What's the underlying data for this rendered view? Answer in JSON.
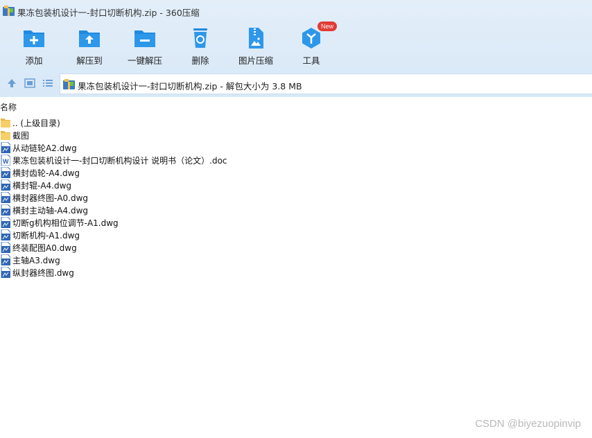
{
  "window": {
    "title": "果冻包装机设计一-封口切断机构.zip - 360压缩"
  },
  "toolbar": {
    "items": [
      {
        "label": "添加",
        "icon": "add-icon"
      },
      {
        "label": "解压到",
        "icon": "extract-to-icon"
      },
      {
        "label": "一键解压",
        "icon": "one-click-extract-icon"
      },
      {
        "label": "删除",
        "icon": "recycle-delete-icon"
      },
      {
        "label": "图片压缩",
        "icon": "image-compress-icon"
      },
      {
        "label": "工具",
        "icon": "tools-icon",
        "badge": "New"
      }
    ]
  },
  "nav": {
    "path": "果冻包装机设计一-封口切断机构.zip - 解包大小为 3.8 MB"
  },
  "list": {
    "column_header": "名称",
    "items": [
      {
        "name": ".. (上级目录)",
        "type": "folder"
      },
      {
        "name": "截图",
        "type": "folder"
      },
      {
        "name": "从动链轮A2.dwg",
        "type": "dwg"
      },
      {
        "name": "果冻包装机设计一-封口切断机构设计 说明书（论文）.doc",
        "type": "doc"
      },
      {
        "name": "横封齿轮-A4.dwg",
        "type": "dwg"
      },
      {
        "name": "横封辊-A4.dwg",
        "type": "dwg"
      },
      {
        "name": "横封器终图-A0.dwg",
        "type": "dwg"
      },
      {
        "name": "横封主动轴-A4.dwg",
        "type": "dwg"
      },
      {
        "name": "切断g机构相位调节-A1.dwg",
        "type": "dwg"
      },
      {
        "name": "切断机构-A1.dwg",
        "type": "dwg"
      },
      {
        "name": "终装配图A0.dwg",
        "type": "dwg"
      },
      {
        "name": "主轴A3.dwg",
        "type": "dwg"
      },
      {
        "name": "纵封器终图.dwg",
        "type": "dwg"
      }
    ]
  },
  "watermark": "CSDN @biyezuopinvip",
  "colors": {
    "toolbar_bg": "#dde9f6",
    "accent_blue": "#1f8ae0",
    "badge_red": "#e23b35",
    "folder_yellow": "#f7cf6a"
  }
}
